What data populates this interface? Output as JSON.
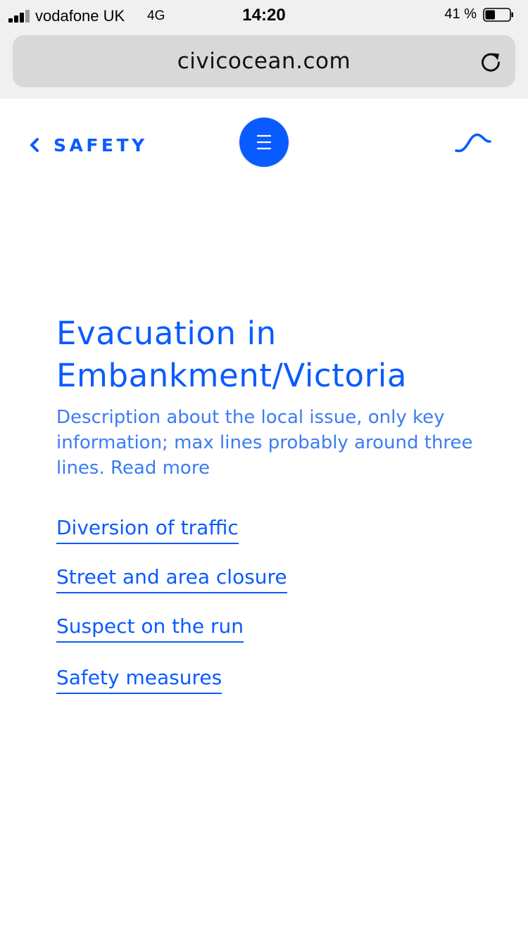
{
  "status_bar": {
    "carrier": "vodafone UK",
    "network": "4G",
    "time": "14:20",
    "battery_percent": "41 %",
    "battery_level": 0.41
  },
  "browser": {
    "url": "civicocean.com"
  },
  "header": {
    "back_label": "SAFETY"
  },
  "main": {
    "title": "Evacuation in Embankment/Victoria",
    "description": "Description about the local issue, only key information; max lines probably around three lines.",
    "read_more": "Read more",
    "links": [
      {
        "label": "Diversion of traffic"
      },
      {
        "label": "Street and area closure"
      },
      {
        "label": "Suspect on the run"
      },
      {
        "label": "Safety measures"
      }
    ]
  },
  "colors": {
    "accent": "#0a5bff",
    "description_text": "#3b7cf5",
    "chrome_background": "#f0f0f0",
    "address_field": "#d8d8d8"
  }
}
